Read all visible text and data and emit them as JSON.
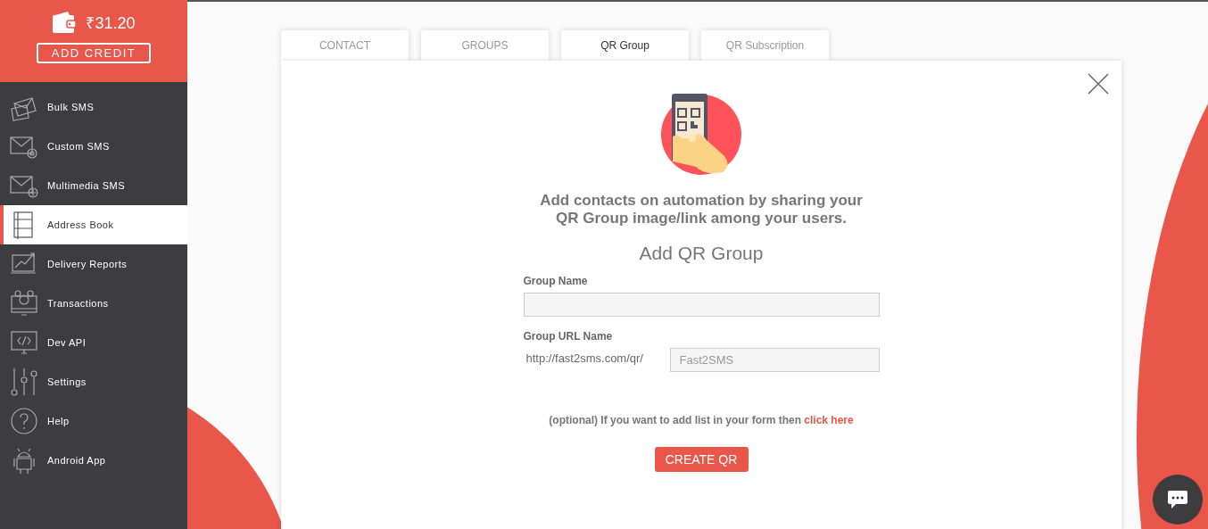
{
  "wallet": {
    "balance": "₹31.20",
    "button": "ADD CREDIT"
  },
  "sidebar": {
    "items": [
      {
        "label": "Bulk SMS",
        "selected": false
      },
      {
        "label": "Custom SMS",
        "selected": false
      },
      {
        "label": "Multimedia SMS",
        "selected": false
      },
      {
        "label": "Address Book",
        "selected": true
      },
      {
        "label": "Delivery Reports",
        "selected": false
      },
      {
        "label": "Transactions",
        "selected": false
      },
      {
        "label": "Dev API",
        "selected": false
      },
      {
        "label": "Settings",
        "selected": false
      },
      {
        "label": "Help",
        "selected": false
      },
      {
        "label": "Android App",
        "selected": false
      }
    ]
  },
  "tabs": [
    {
      "label": "CONTACT",
      "selected": false
    },
    {
      "label": "GROUPS",
      "selected": false
    },
    {
      "label": "QR Group",
      "selected": true
    },
    {
      "label": "QR Subscription",
      "selected": false
    }
  ],
  "panel": {
    "intro": "Add contacts on automation by sharing your QR Group image/link among your users.",
    "heading": "Add QR Group",
    "group_name": {
      "label": "Group Name"
    },
    "group_url": {
      "label": "Group URL Name",
      "prefix": "http://fast2sms.com/qr/",
      "placeholder": "Fast2SMS"
    },
    "optional_note": "(optional) If you want to add list in your form then",
    "link": "click here",
    "button": "CREATE QR"
  }
}
